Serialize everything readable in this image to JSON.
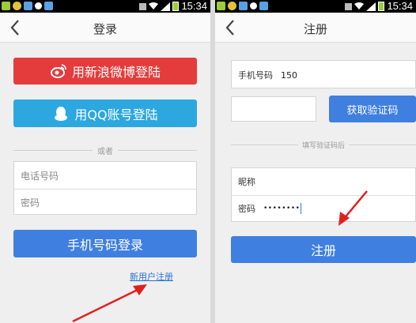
{
  "status_bar": {
    "time": "15:34"
  },
  "login_screen": {
    "title": "登录",
    "weibo_button": "用新浪微博登陆",
    "qq_button": "用QQ账号登陆",
    "divider_text": "或者",
    "phone_placeholder": "电话号码",
    "password_placeholder": "密码",
    "phone_login_button": "手机号码登录",
    "register_link": "新用户注册"
  },
  "register_screen": {
    "title": "注册",
    "phone_label": "手机号码",
    "phone_value": "150",
    "get_code_button": "获取验证码",
    "divider_text": "填写验证码后",
    "nickname_label": "昵称",
    "password_label": "密码",
    "password_dots": "••••••••",
    "register_button": "注册"
  },
  "colors": {
    "weibo_red": "#e43c3c",
    "qq_blue": "#2ca7e0",
    "primary_blue": "#3f7fe0",
    "arrow_red": "#e02020"
  },
  "icons": [
    "back-arrow-icon",
    "weibo-icon",
    "qq-penguin-icon",
    "wifi-icon",
    "signal-icon",
    "battery-icon",
    "red-arrow-annotation"
  ]
}
